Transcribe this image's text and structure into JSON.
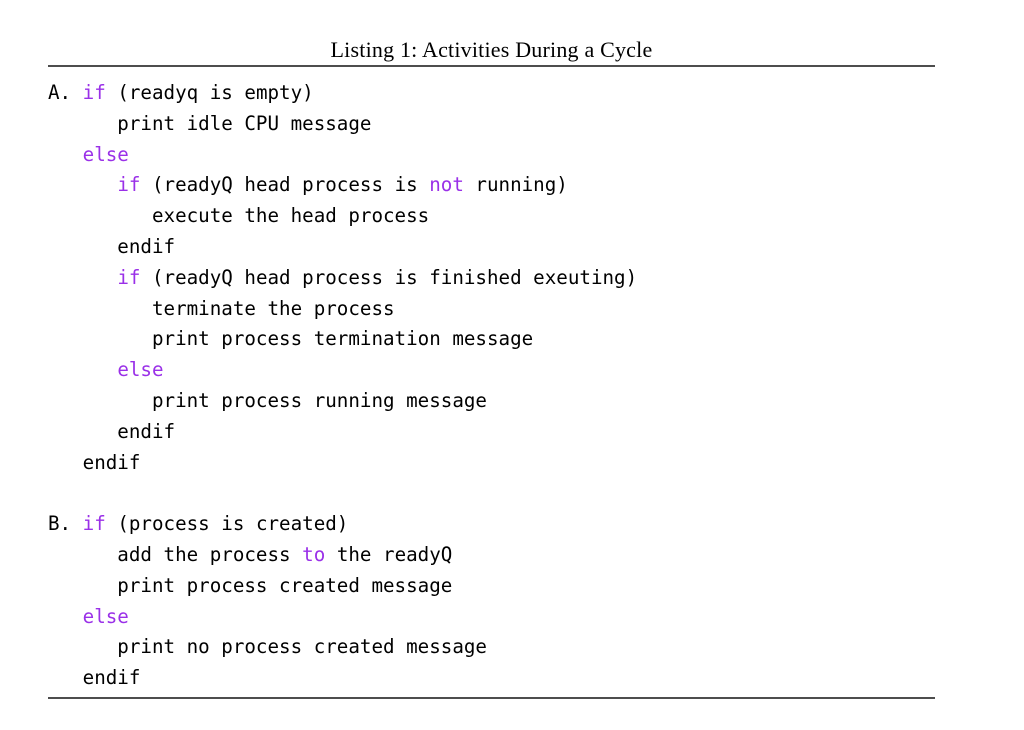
{
  "document": {
    "type": "latex-code-listing",
    "background_color": "#ffffff",
    "text_color": "#000000",
    "keyword_color": "#9a30e8",
    "rule_color": "#4d4d4d"
  },
  "caption": {
    "text": "Listing 1: Activities During a Cycle"
  },
  "code": {
    "lines": [
      {
        "id": "line-01",
        "runs": [
          {
            "text": "A. ",
            "kind": "plain"
          },
          {
            "text": "if",
            "kind": "keyword"
          },
          {
            "text": " (readyq is empty)",
            "kind": "plain"
          }
        ]
      },
      {
        "id": "line-02",
        "runs": [
          {
            "text": "      print idle CPU message",
            "kind": "plain"
          }
        ]
      },
      {
        "id": "line-03",
        "runs": [
          {
            "text": "   ",
            "kind": "plain"
          },
          {
            "text": "else",
            "kind": "keyword"
          }
        ]
      },
      {
        "id": "line-04",
        "runs": [
          {
            "text": "      ",
            "kind": "plain"
          },
          {
            "text": "if",
            "kind": "keyword"
          },
          {
            "text": " (readyQ head process is ",
            "kind": "plain"
          },
          {
            "text": "not",
            "kind": "keyword"
          },
          {
            "text": " running)",
            "kind": "plain"
          }
        ]
      },
      {
        "id": "line-05",
        "runs": [
          {
            "text": "         execute the head process",
            "kind": "plain"
          }
        ]
      },
      {
        "id": "line-06",
        "runs": [
          {
            "text": "      endif",
            "kind": "plain"
          }
        ]
      },
      {
        "id": "line-07",
        "runs": [
          {
            "text": "      ",
            "kind": "plain"
          },
          {
            "text": "if",
            "kind": "keyword"
          },
          {
            "text": " (readyQ head process is finished exeuting)",
            "kind": "plain"
          }
        ]
      },
      {
        "id": "line-08",
        "runs": [
          {
            "text": "         terminate the process",
            "kind": "plain"
          }
        ]
      },
      {
        "id": "line-09",
        "runs": [
          {
            "text": "         print process termination message",
            "kind": "plain"
          }
        ]
      },
      {
        "id": "line-10",
        "runs": [
          {
            "text": "      ",
            "kind": "plain"
          },
          {
            "text": "else",
            "kind": "keyword"
          }
        ]
      },
      {
        "id": "line-11",
        "runs": [
          {
            "text": "         print process running message",
            "kind": "plain"
          }
        ]
      },
      {
        "id": "line-12",
        "runs": [
          {
            "text": "      endif",
            "kind": "plain"
          }
        ]
      },
      {
        "id": "line-13",
        "runs": [
          {
            "text": "   endif",
            "kind": "plain"
          }
        ]
      },
      {
        "id": "line-14",
        "runs": [
          {
            "text": "",
            "kind": "plain"
          }
        ]
      },
      {
        "id": "line-15",
        "runs": [
          {
            "text": "B. ",
            "kind": "plain"
          },
          {
            "text": "if",
            "kind": "keyword"
          },
          {
            "text": " (process is created)",
            "kind": "plain"
          }
        ]
      },
      {
        "id": "line-16",
        "runs": [
          {
            "text": "      add the process ",
            "kind": "plain"
          },
          {
            "text": "to",
            "kind": "keyword"
          },
          {
            "text": " the readyQ",
            "kind": "plain"
          }
        ]
      },
      {
        "id": "line-17",
        "runs": [
          {
            "text": "      print process created message",
            "kind": "plain"
          }
        ]
      },
      {
        "id": "line-18",
        "runs": [
          {
            "text": "   ",
            "kind": "plain"
          },
          {
            "text": "else",
            "kind": "keyword"
          }
        ]
      },
      {
        "id": "line-19",
        "runs": [
          {
            "text": "      print no process created message",
            "kind": "plain"
          }
        ]
      },
      {
        "id": "line-20",
        "runs": [
          {
            "text": "   endif",
            "kind": "plain"
          }
        ]
      }
    ]
  }
}
